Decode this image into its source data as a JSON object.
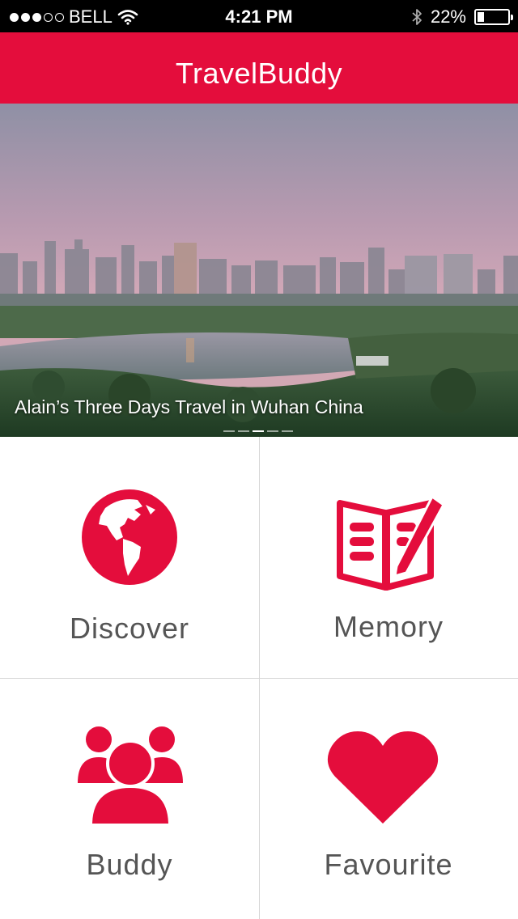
{
  "status_bar": {
    "carrier": "BELL",
    "time": "4:21 PM",
    "battery_text": "22%",
    "battery_level": 0.22,
    "signal_bars": 3,
    "signal_total": 5
  },
  "header": {
    "title": "TravelBuddy"
  },
  "hero": {
    "caption": "Alain’s Three Days Travel in Wuhan China",
    "page_count": 5,
    "active_page": 3
  },
  "menu": [
    {
      "label": "Discover",
      "icon": "globe-icon"
    },
    {
      "label": "Memory",
      "icon": "notebook-pen-icon"
    },
    {
      "label": "Buddy",
      "icon": "group-icon"
    },
    {
      "label": "Favourite",
      "icon": "heart-icon"
    }
  ],
  "colors": {
    "accent": "#e40d3c",
    "text": "#555555",
    "divider": "#d6d6d6"
  }
}
